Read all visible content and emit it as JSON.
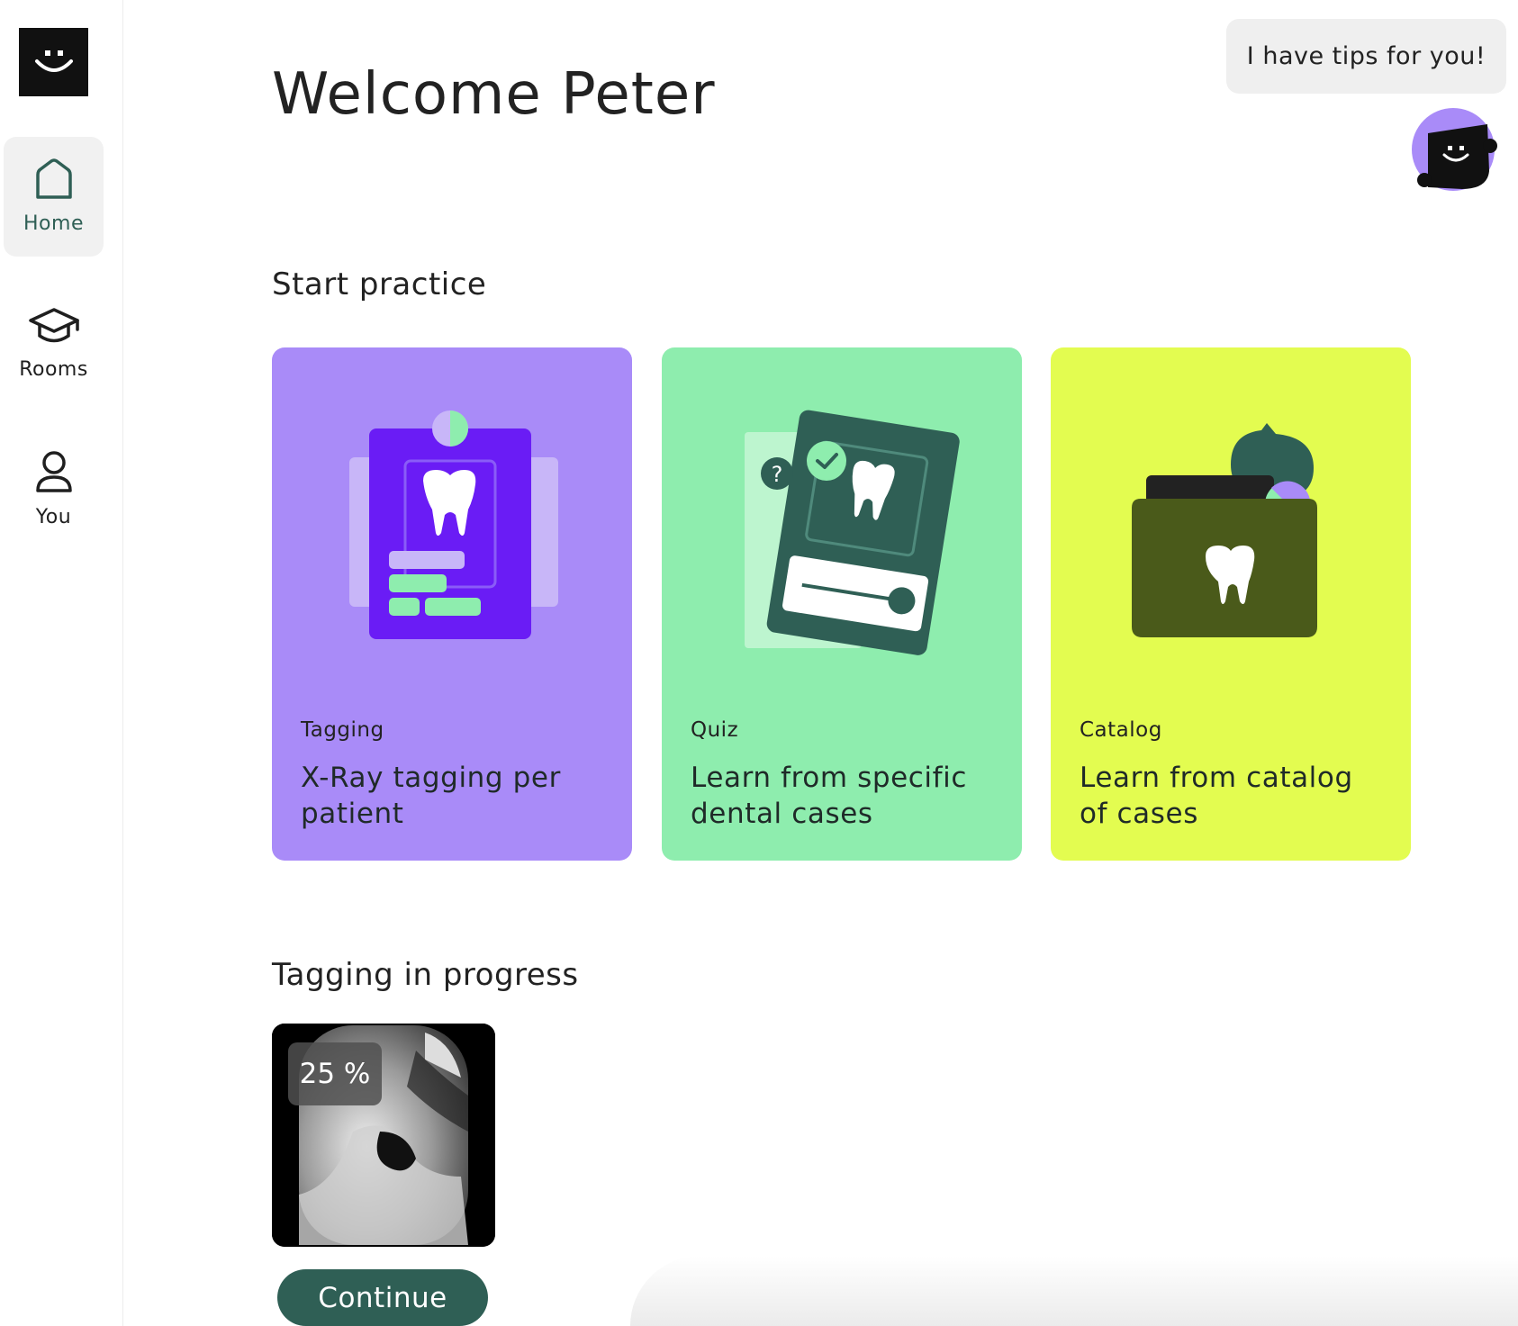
{
  "sidebar": {
    "logo_icon": "smiley-logo-icon",
    "items": [
      {
        "label": "Home",
        "icon": "home-icon",
        "active": true
      },
      {
        "label": "Rooms",
        "icon": "graduation-cap-icon",
        "active": false
      },
      {
        "label": "You",
        "icon": "user-icon",
        "active": false
      }
    ]
  },
  "header": {
    "title": "Welcome Peter"
  },
  "tips": {
    "bubble_text": "I have tips for you!",
    "assistant_icon": "assistant-avatar-icon"
  },
  "start_practice": {
    "heading": "Start practice",
    "cards": [
      {
        "category": "Tagging",
        "description": "X-Ray tagging per patient",
        "color": "#a98bf8"
      },
      {
        "category": "Quiz",
        "description": "Learn from specific dental cases",
        "color": "#8eedae"
      },
      {
        "category": "Catalog",
        "description": "Learn from catalog of cases",
        "color": "#e3fc50"
      }
    ]
  },
  "in_progress": {
    "heading": "Tagging in progress",
    "progress_label": "25 %",
    "progress": 0.25,
    "continue_label": "Continue"
  },
  "colors": {
    "accent": "#2f5f55",
    "tagging_card": "#a98bf8",
    "quiz_card": "#8eedae",
    "catalog_card": "#e3fc50"
  }
}
